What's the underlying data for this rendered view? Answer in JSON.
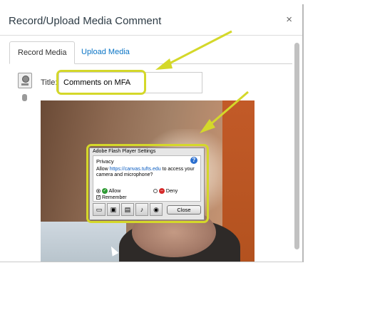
{
  "dialog": {
    "title": "Record/Upload Media Comment",
    "close_label": "×"
  },
  "tabs": [
    {
      "label": "Record Media",
      "active": true
    },
    {
      "label": "Upload Media",
      "active": false
    }
  ],
  "title_field": {
    "label": "Title:",
    "value": "Comments on MFA"
  },
  "flash_settings": {
    "title": "Adobe Flash Player Settings",
    "section": "Privacy",
    "message_prefix": "Allow ",
    "message_link": "https://canvas.tufts.edu",
    "message_suffix": " to access your camera and microphone?",
    "allow_label": "Allow",
    "deny_label": "Deny",
    "remember_label": "Remember",
    "close_label": "Close",
    "help_label": "?"
  },
  "colors": {
    "highlight": "#d4d82a",
    "link": "#0a74c5",
    "title_text": "#2d3b45"
  }
}
